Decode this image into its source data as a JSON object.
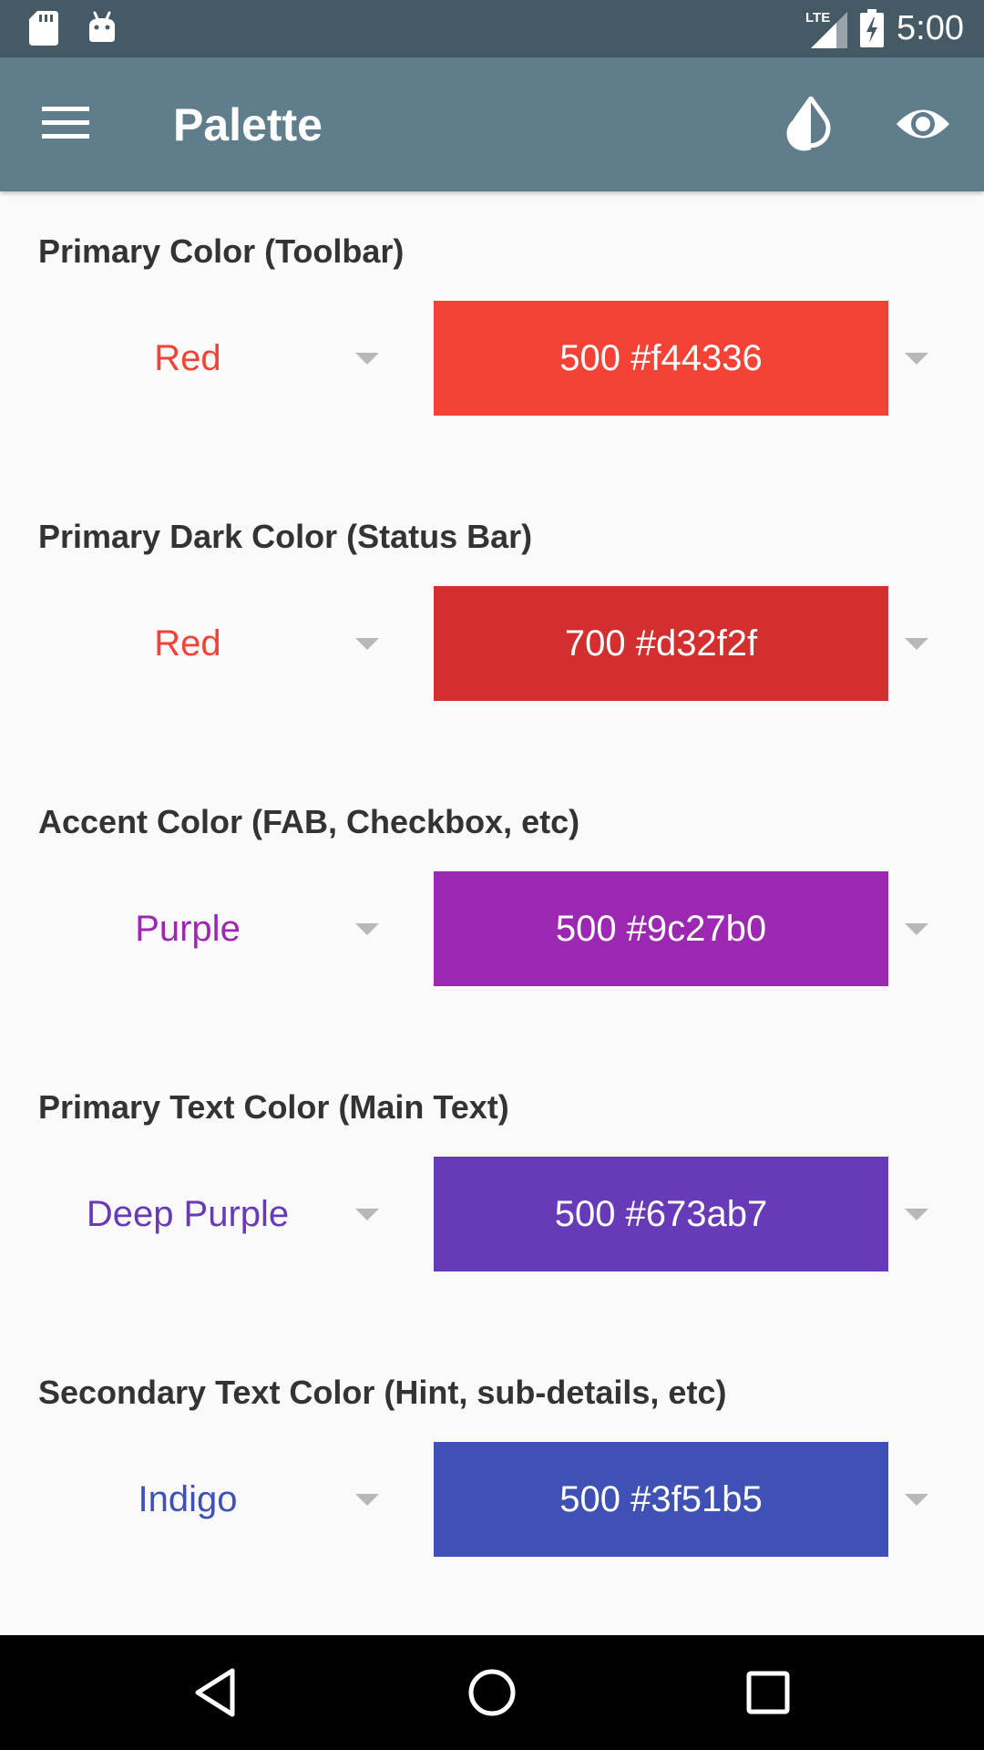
{
  "status_bar": {
    "time": "5:00",
    "network_label": "LTE",
    "icons": [
      "sd-card-icon",
      "android-icon",
      "lte-signal-icon",
      "battery-charging-icon"
    ]
  },
  "toolbar": {
    "title": "Palette",
    "icons": [
      "menu-icon",
      "invert-colors-icon",
      "eye-icon"
    ],
    "background": "#607d8b"
  },
  "sections": [
    {
      "label": "Primary Color (Toolbar)",
      "color_name": "Red",
      "color_name_color": "#f44336",
      "swatch_label": "500 #f44336",
      "swatch_color": "#f44336"
    },
    {
      "label": "Primary Dark Color (Status Bar)",
      "color_name": "Red",
      "color_name_color": "#f44336",
      "swatch_label": "700 #d32f2f",
      "swatch_color": "#d32f2f"
    },
    {
      "label": "Accent Color (FAB, Checkbox, etc)",
      "color_name": "Purple",
      "color_name_color": "#9c27b0",
      "swatch_label": "500 #9c27b0",
      "swatch_color": "#9c27b0"
    },
    {
      "label": "Primary Text Color (Main Text)",
      "color_name": "Deep Purple",
      "color_name_color": "#673ab7",
      "swatch_label": "500 #673ab7",
      "swatch_color": "#673ab7"
    },
    {
      "label": "Secondary Text Color (Hint, sub-details, etc)",
      "color_name": "Indigo",
      "color_name_color": "#3f51b5",
      "swatch_label": "500 #3f51b5",
      "swatch_color": "#3f51b5"
    }
  ],
  "nav_bar": {
    "icons": [
      "back-icon",
      "home-icon",
      "recents-icon"
    ]
  }
}
